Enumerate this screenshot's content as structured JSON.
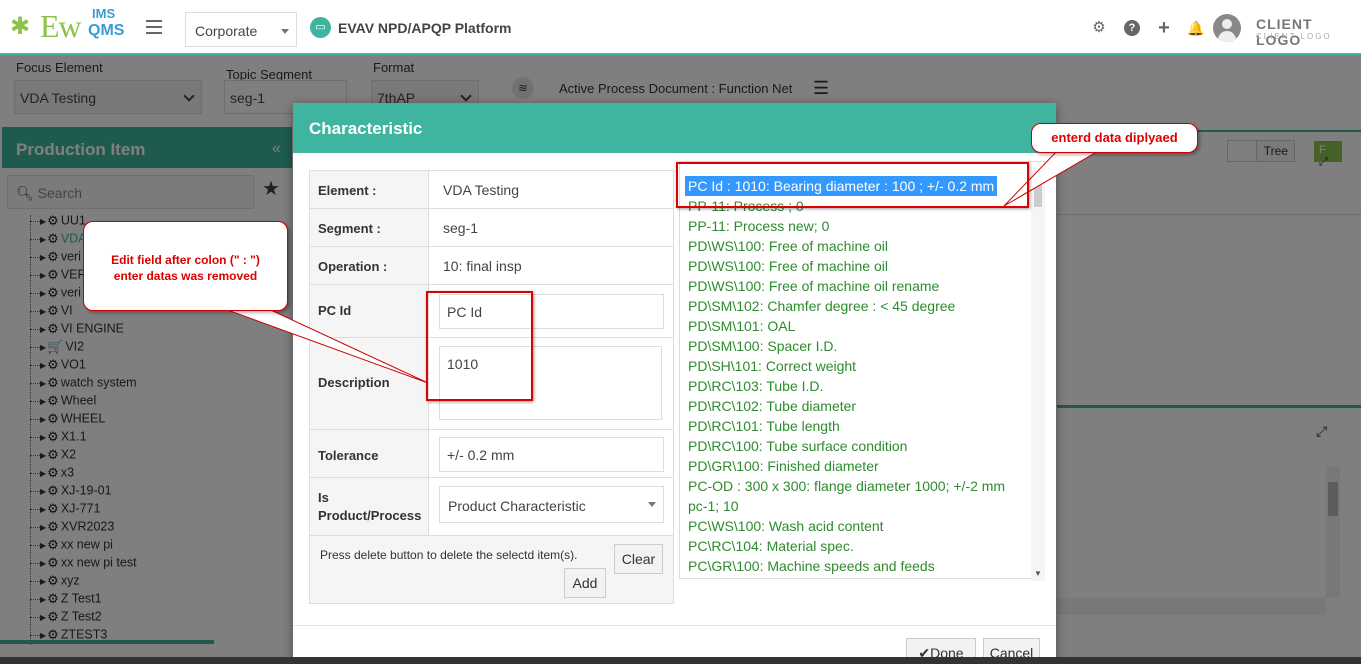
{
  "topbar": {
    "logo_main": "Ew",
    "logo_ims": "IMS",
    "logo_qms": "QMS",
    "org_select": "Corporate",
    "platform_title": "EVAV NPD/APQP Platform",
    "client_logo": "CLIENT LOGO",
    "client_logo_sub": "CLIENT LOGO",
    "icons": [
      "gear-icon",
      "help-icon",
      "plus-icon",
      "bell-icon",
      "avatar"
    ]
  },
  "filters": {
    "focus_label": "Focus Element",
    "focus_value": "VDA Testing",
    "topic_label": "Topic Segment",
    "topic_value": "seg-1",
    "format_label": "Format",
    "format_value": "7thAP",
    "active_doc": "Active Process Document : Function Net"
  },
  "left_panel": {
    "title": "Production Item",
    "search_placeholder": "Search",
    "items": [
      "UU1",
      "VDA",
      "veri",
      "VER",
      "veri",
      "VI",
      "VI ENGINE",
      "VI2",
      "VO1",
      "watch system",
      "Wheel",
      "WHEEL",
      "X1.1",
      "X2",
      "x3",
      "XJ-19-01",
      "XJ-771",
      "XVR2023",
      "xx new pi",
      "xx new pi test",
      "xyz",
      "Z Test1",
      "Z Test2",
      "ZTEST3"
    ]
  },
  "right_panel": {
    "tree_toggle": "Tree",
    "f_button": "F"
  },
  "dialog": {
    "title": "Characteristic",
    "element_label": "Element :",
    "element_value": "VDA Testing",
    "segment_label": "Segment :",
    "segment_value": "seg-1",
    "operation_label": "Operation :",
    "operation_value": "10: final insp",
    "pcid_label": "PC Id",
    "pcid_value": "PC Id",
    "description_label": "Description",
    "description_value": "1010",
    "tolerance_label": "Tolerance",
    "tolerance_value": "+/- 0.2 mm",
    "isproduct_label_1": "Is",
    "isproduct_label_2": "Product/Process",
    "isproduct_value": "Product Characteristic",
    "note": "Press delete button to delete the selectd item(s).",
    "clear": "Clear",
    "add": "Add",
    "done": "Done",
    "cancel": "Cancel",
    "list": [
      "PC Id : 1010: Bearing diameter : 100 ; +/- 0.2 mm",
      "PP-11: Process ; 0",
      "PP-11: Process new; 0",
      "PD\\WS\\100: Free of machine oil",
      "PD\\WS\\100: Free of machine oil",
      "PD\\WS\\100: Free of machine oil rename",
      "PD\\SM\\102: Chamfer degree : < 45 degree",
      "PD\\SM\\101: OAL",
      "PD\\SM\\100: Spacer I.D.",
      "PD\\SH\\101: Correct weight",
      "PD\\RC\\103: Tube I.D.",
      "PD\\RC\\102: Tube diameter",
      "PD\\RC\\101: Tube length",
      "PD\\RC\\100: Tube surface condition",
      "PD\\GR\\100: Finished diameter",
      "PC-OD : 300 x 300: flange diameter 1000; +/-2 mm",
      "pc-1; 10",
      "PC\\WS\\100: Wash acid content",
      "PC\\RC\\104: Material spec.",
      "PC\\GR\\100: Machine speeds and feeds"
    ]
  },
  "callouts": {
    "left_line1": "Edit field after colon (\" : \")",
    "left_line2": "enter datas was removed",
    "right": "enterd data diplyaed"
  }
}
